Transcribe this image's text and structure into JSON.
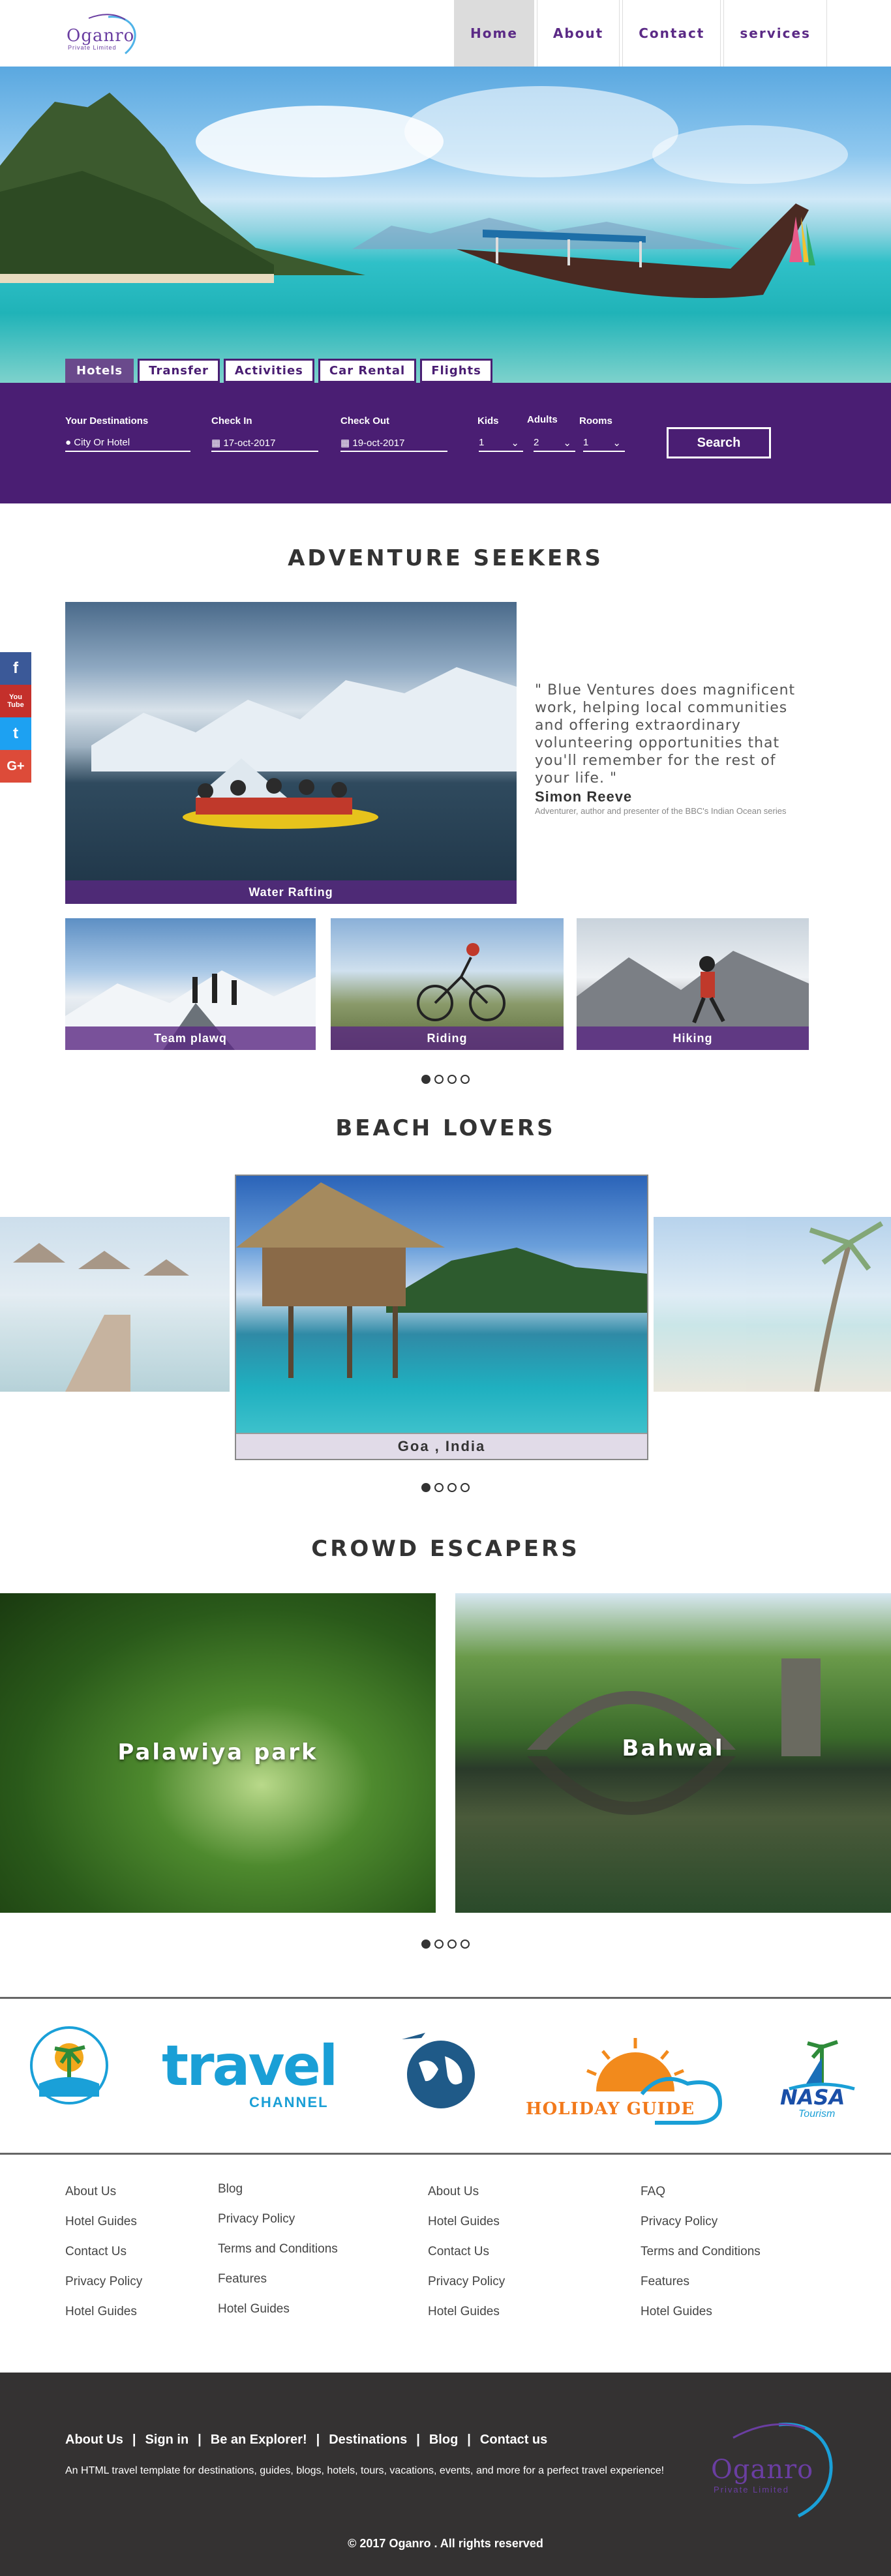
{
  "brand": {
    "name": "Oganro",
    "tagline": "Private Limited"
  },
  "nav": [
    "Home",
    "About",
    "Contact",
    "services"
  ],
  "search_tabs": [
    "Hotels",
    "Transfer",
    "Activities",
    "Car Rental",
    "Flights"
  ],
  "search": {
    "destinations_label": "Your Destinations",
    "destinations_placeholder": "City Or Hotel",
    "checkin_label": "Check In",
    "checkin_value": "17-oct-2017",
    "checkout_label": "Check Out",
    "checkout_value": "19-oct-2017",
    "kids_label": "Kids",
    "kids_value": "1",
    "adults_label": "Adults",
    "adults_value": "2",
    "rooms_label": "Rooms",
    "rooms_value": "1",
    "button": "Search"
  },
  "social": {
    "facebook": "f",
    "youtube": "You Tube",
    "twitter": "t",
    "google": "G+"
  },
  "adventure": {
    "title": "ADVENTURE SEEKERS",
    "main_caption": "Water Rafting",
    "quote": "\" Blue Ventures does magnificent work, helping local communities and offering extraordinary volunteering opportunities that you'll remember for the rest of your life. \"",
    "author": "Simon Reeve",
    "author_role": "Adventurer, author and presenter of the BBC's Indian Ocean series",
    "thumbs": [
      "Team plawq",
      "Riding",
      "Hiking"
    ]
  },
  "beach": {
    "title": "BEACH LOVERS",
    "caption": "Goa , India"
  },
  "crowd": {
    "title": "CROWD ESCAPERS",
    "left": "Palawiya park",
    "right": "Bahwal"
  },
  "partners": {
    "travel": "travel",
    "travel_sub": "CHANNEL",
    "holiday": "HOLIDAY GUIDE",
    "nasa": "NASA",
    "nasa_sub": "Tourism"
  },
  "link_columns": [
    [
      "About Us",
      "Hotel Guides",
      "Contact Us",
      "Privacy Policy",
      "Hotel Guides"
    ],
    [
      "Blog",
      "Privacy Policy",
      "Terms and Conditions",
      "Features",
      "Hotel Guides"
    ],
    [
      "About Us",
      "Hotel Guides",
      "Contact Us",
      "Privacy Policy",
      "Hotel Guides"
    ],
    [
      "FAQ",
      "Privacy Policy",
      "Terms and Conditions",
      "Features",
      "Hotel Guides"
    ]
  ],
  "footer": {
    "links": [
      "About Us",
      "Sign in",
      "Be an Explorer!",
      "Destinations",
      "Blog",
      "Contact us"
    ],
    "separator": "|",
    "description": "An HTML travel template for destinations, guides, blogs, hotels, tours, vacations, events, and more for a perfect travel experience!",
    "copyright": "© 2017 Oganro . All rights reserved"
  },
  "colors": {
    "primary": "#4a1e73",
    "accent": "#6a3ea1",
    "footer": "#343232"
  }
}
